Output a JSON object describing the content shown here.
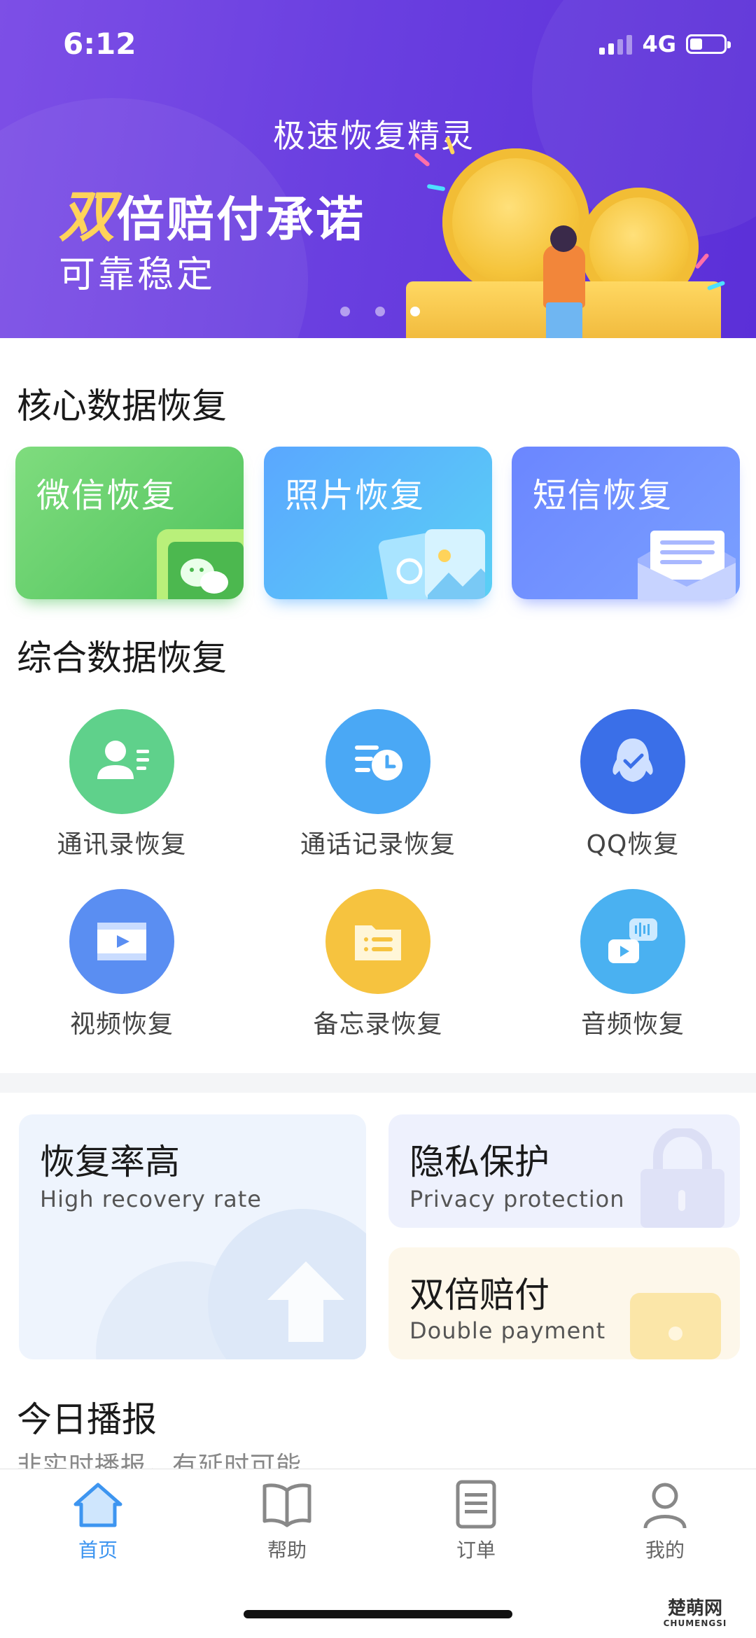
{
  "status_bar": {
    "time": "6:12",
    "network": "4G"
  },
  "banner": {
    "title": "极速恢复精灵",
    "line2_highlight": "双",
    "line2_rest": "倍赔付承诺",
    "line3": "可靠稳定",
    "page_count": 3,
    "active_page": 3
  },
  "core_section": {
    "title": "核心数据恢复",
    "cards": [
      {
        "label": "微信恢复",
        "icon": "wechat-icon"
      },
      {
        "label": "照片恢复",
        "icon": "photo-icon"
      },
      {
        "label": "短信恢复",
        "icon": "envelope-icon"
      }
    ]
  },
  "general_section": {
    "title": "综合数据恢复",
    "items": [
      {
        "label": "通讯录恢复",
        "icon": "contacts-icon",
        "color": "#5fd18b"
      },
      {
        "label": "通话记录恢复",
        "icon": "call-log-icon",
        "color": "#4aa8f5"
      },
      {
        "label": "QQ恢复",
        "icon": "qq-icon",
        "color": "#3a6fe8"
      },
      {
        "label": "视频恢复",
        "icon": "video-icon",
        "color": "#5a8ef2"
      },
      {
        "label": "备忘录恢复",
        "icon": "memo-icon",
        "color": "#f6c33f"
      },
      {
        "label": "音频恢复",
        "icon": "audio-icon",
        "color": "#4ab1f1"
      }
    ]
  },
  "features": {
    "rate": {
      "title": "恢复率高",
      "subtitle": "High recovery rate"
    },
    "privacy": {
      "title": "隐私保护",
      "subtitle": "Privacy protection"
    },
    "double": {
      "title": "双倍赔付",
      "subtitle": "Double payment"
    }
  },
  "today": {
    "title": "今日播报",
    "subtitle": "非实时播报，有延时可能"
  },
  "tabbar": {
    "tabs": [
      {
        "label": "首页",
        "icon": "home-icon",
        "active": true
      },
      {
        "label": "帮助",
        "icon": "book-icon",
        "active": false
      },
      {
        "label": "订单",
        "icon": "order-icon",
        "active": false
      },
      {
        "label": "我的",
        "icon": "profile-icon",
        "active": false
      }
    ],
    "active_color": "#3d95f0"
  },
  "watermark": {
    "text": "楚萌网",
    "sub": "CHUMENGSI"
  }
}
